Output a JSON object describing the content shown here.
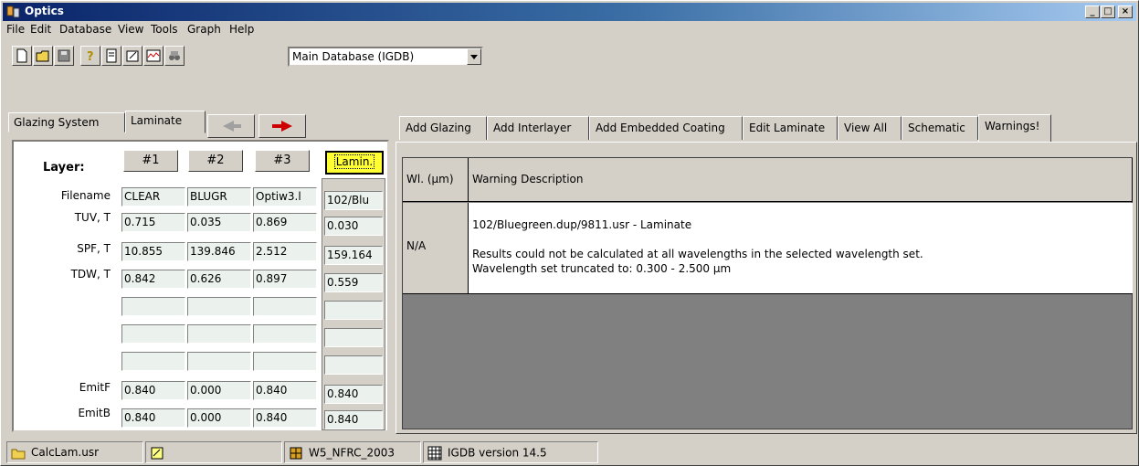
{
  "window": {
    "title": "Optics",
    "minimize": "_",
    "maximize": "□",
    "close": "×"
  },
  "menu": [
    "File",
    "Edit",
    "Database",
    "View",
    "Tools",
    "Graph",
    "Help"
  ],
  "toolbar": {
    "icons": [
      "new-file-icon",
      "open-folder-icon",
      "save-icon",
      "help-icon",
      "report-icon",
      "edit-form-icon",
      "graph-icon",
      "binoculars-icon"
    ],
    "database_select": "Main Database (IGDB)"
  },
  "left_tabs": [
    "Glazing System",
    "Laminate"
  ],
  "arrows": {
    "back": "◄",
    "forward": "➜"
  },
  "layers": {
    "label": "Layer:",
    "columns": [
      "#1",
      "#2",
      "#3"
    ],
    "lamin_button": "Lamin.",
    "row_labels": [
      "Filename",
      "TUV, T",
      "SPF, T",
      "TDW, T",
      "",
      "",
      "",
      "EmitF",
      "EmitB"
    ],
    "values": [
      [
        "CLEAR",
        "BLUGR",
        "Optiw3.l",
        "102/Blu"
      ],
      [
        "0.715",
        "0.035",
        "0.869",
        "0.030"
      ],
      [
        "10.855",
        "139.846",
        "2.512",
        "159.164"
      ],
      [
        "0.842",
        "0.626",
        "0.897",
        "0.559"
      ],
      [
        "",
        "",
        "",
        ""
      ],
      [
        "",
        "",
        "",
        ""
      ],
      [
        "",
        "",
        "",
        ""
      ],
      [
        "0.840",
        "0.000",
        "0.840",
        "0.840"
      ],
      [
        "0.840",
        "0.000",
        "0.840",
        "0.840"
      ]
    ]
  },
  "right_tabs": [
    "Add Glazing",
    "Add Interlayer",
    "Add Embedded Coating",
    "Edit Laminate",
    "View All",
    "Schematic",
    "Warnings!"
  ],
  "warnings": {
    "headers": [
      "Wl. (µm)",
      "Warning Description"
    ],
    "rows": [
      {
        "wl": "N/A",
        "lines": [
          "102/Bluegreen.dup/9811.usr - Laminate",
          "",
          "Results could not be calculated at all wavelengths in the selected wavelength set.",
          "Wavelength set truncated to: 0.300 - 2.500 µm"
        ]
      }
    ]
  },
  "status": {
    "file": "CalcLam.usr",
    "config": "W5_NFRC_2003",
    "db_version": "IGDB version 14.5"
  }
}
